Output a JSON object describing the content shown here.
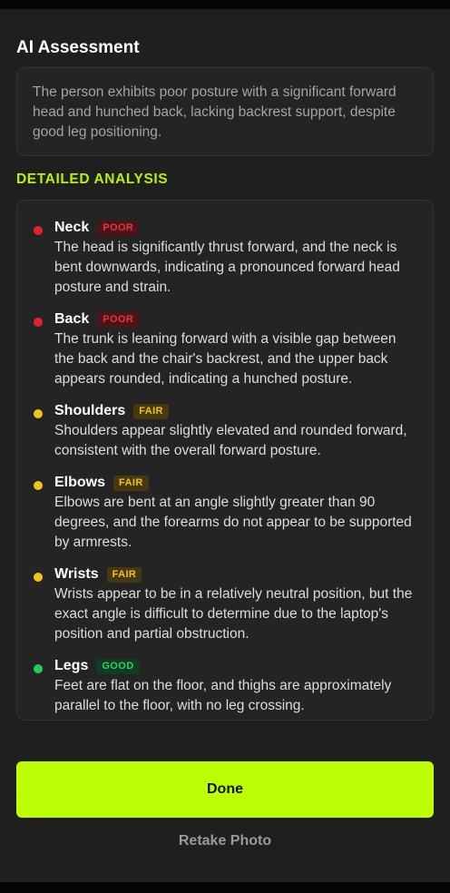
{
  "header": {
    "title": "AI Assessment"
  },
  "summary": {
    "text": "The person exhibits poor posture with a significant forward head and hunched back, lacking backrest support, despite good leg positioning."
  },
  "analysis": {
    "heading": "DETAILED ANALYSIS",
    "items": [
      {
        "name": "Neck",
        "rating": "POOR",
        "description": "The head is significantly thrust forward, and the neck is bent downwards, indicating a pronounced forward head posture and strain."
      },
      {
        "name": "Back",
        "rating": "POOR",
        "description": "The trunk is leaning forward with a visible gap between the back and the chair's backrest, and the upper back appears rounded, indicating a hunched posture."
      },
      {
        "name": "Shoulders",
        "rating": "FAIR",
        "description": "Shoulders appear slightly elevated and rounded forward, consistent with the overall forward posture."
      },
      {
        "name": "Elbows",
        "rating": "FAIR",
        "description": "Elbows are bent at an angle slightly greater than 90 degrees, and the forearms do not appear to be supported by armrests."
      },
      {
        "name": "Wrists",
        "rating": "FAIR",
        "description": "Wrists appear to be in a relatively neutral position, but the exact angle is difficult to determine due to the laptop's position and partial obstruction."
      },
      {
        "name": "Legs",
        "rating": "GOOD",
        "description": "Feet are flat on the floor, and thighs are approximately parallel to the floor, with no leg crossing."
      }
    ]
  },
  "actions": {
    "done_label": "Done",
    "retake_label": "Retake Photo"
  },
  "colors": {
    "accent": "#bcfe04",
    "poor": "#e8202a",
    "fair": "#f3c318",
    "good": "#1fcf5a"
  }
}
